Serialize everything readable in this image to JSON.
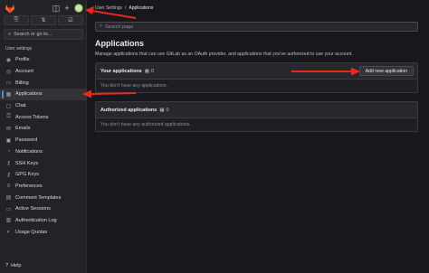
{
  "sidebar": {
    "quick_actions": [
      "merge-requests-icon",
      "issues-icon",
      "todo-icon"
    ],
    "search_label": "Search or go to...",
    "section_label": "User settings",
    "items": [
      {
        "label": "Profile",
        "icon": "profile-icon"
      },
      {
        "label": "Account",
        "icon": "account-icon"
      },
      {
        "label": "Billing",
        "icon": "billing-icon"
      },
      {
        "label": "Applications",
        "icon": "applications-icon",
        "active": true
      },
      {
        "label": "Chat",
        "icon": "chat-icon"
      },
      {
        "label": "Access Tokens",
        "icon": "token-icon"
      },
      {
        "label": "Emails",
        "icon": "email-icon"
      },
      {
        "label": "Password",
        "icon": "lock-icon"
      },
      {
        "label": "Notifications",
        "icon": "bell-icon"
      },
      {
        "label": "SSH Keys",
        "icon": "key-icon"
      },
      {
        "label": "GPG Keys",
        "icon": "key-icon"
      },
      {
        "label": "Preferences",
        "icon": "preferences-icon"
      },
      {
        "label": "Comment Templates",
        "icon": "comment-icon"
      },
      {
        "label": "Active Sessions",
        "icon": "monitor-icon"
      },
      {
        "label": "Authentication Log",
        "icon": "log-icon"
      },
      {
        "label": "Usage Quotas",
        "icon": "quota-icon"
      }
    ],
    "help_label": "Help"
  },
  "breadcrumb": {
    "parent": "User Settings",
    "separator": "/",
    "current": "Applications"
  },
  "search": {
    "placeholder": "Search page"
  },
  "page": {
    "title": "Applications",
    "description": "Manage applications that can use GitLab as an OAuth provider, and applications that you've authorized to use your account."
  },
  "your_applications": {
    "title": "Your applications",
    "count": "0",
    "add_button": "Add new application",
    "empty_text": "You don't have any applications."
  },
  "authorized_applications": {
    "title": "Authorized applications",
    "count": "0",
    "empty_text": "You don't have any authorized applications."
  },
  "colors": {
    "annotation_arrow": "#e8291c",
    "accent": "#428fdc",
    "brand_orange": "#fc6d26"
  }
}
